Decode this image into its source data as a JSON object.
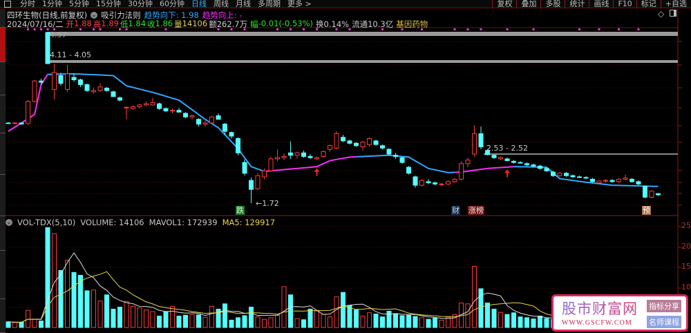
{
  "toolbar": {
    "tabs": [
      "分时",
      "1分钟",
      "5分钟",
      "15分钟",
      "30分钟",
      "60分钟",
      "日线",
      "周线",
      "月线",
      "多周期",
      "更多 >"
    ],
    "active_tab": "日线",
    "right_buttons": [
      "复权",
      "叠加",
      "多股",
      "统计",
      "画线",
      "F10",
      "标记",
      "+自选"
    ]
  },
  "title": {
    "stock": "四环生物(日线,前复权)",
    "indicator": "吸引力法则",
    "trend_down": "趋势向下: 1.98",
    "trend_up": "趋势向上: -"
  },
  "quote": {
    "date": "2024/07/16/二",
    "open_label": "开",
    "open": "1.88",
    "high_label": "高",
    "high": "1.89",
    "low_label": "低",
    "low": "1.84",
    "close_label": "收",
    "close": "1.86",
    "vol_label": "量",
    "vol": "14106",
    "amount": "额262.7万",
    "change_label": "幅",
    "change": "-0.01(-0.53%)",
    "turnover": "换0.14%",
    "float": "流通10.3亿",
    "sector": "基因药物"
  },
  "annotations": {
    "high_mark": "4.57",
    "band1": "4.11 - 4.05",
    "low_mark": "←1.72",
    "band2": "2.53 - 2.52",
    "tag_die": "跌",
    "tag_cai": "财",
    "tag_zhangbang": "涨榜",
    "tag_yu": "预"
  },
  "volume_header": {
    "name": "VOL-TDX(5,10)",
    "volume": "VOLUME: 14106",
    "mavol1": "MAVOL1: 172939",
    "ma5": "MA5: 129917"
  },
  "volume_axis": [
    "25",
    "20",
    "15",
    "10"
  ],
  "watermark": {
    "title": "股市财富网",
    "url": "WWW.GSCFW.COM",
    "btn1": "指标分享",
    "btn2": "名师课程"
  },
  "colors": {
    "up": "#ff3c3c",
    "down": "#54ffff",
    "trend_up": "#ff2cff",
    "trend_down": "#2fa8ff",
    "bg": "#000000"
  },
  "chart_data": {
    "type": "candlestick",
    "ylim": [
      1.55,
      4.6
    ],
    "ohlc": [
      [
        3.06,
        3.07,
        3.04,
        3.05
      ],
      [
        3.05,
        3.07,
        3.04,
        3.06
      ],
      [
        3.06,
        3.07,
        3.03,
        3.04
      ],
      [
        3.05,
        3.44,
        3.03,
        3.42
      ],
      [
        3.42,
        3.78,
        3.4,
        3.76
      ],
      [
        3.76,
        3.8,
        3.7,
        3.74
      ],
      [
        4.57,
        4.57,
        4.05,
        4.05
      ],
      [
        3.62,
        4.05,
        3.45,
        3.9
      ],
      [
        3.85,
        3.9,
        3.68,
        3.72
      ],
      [
        3.62,
        4.03,
        3.58,
        3.88
      ],
      [
        3.82,
        3.88,
        3.75,
        3.78
      ],
      [
        3.78,
        3.8,
        3.66,
        3.7
      ],
      [
        3.7,
        3.72,
        3.58,
        3.6
      ],
      [
        3.58,
        3.65,
        3.55,
        3.6
      ],
      [
        3.6,
        3.72,
        3.58,
        3.66
      ],
      [
        3.64,
        3.66,
        3.58,
        3.6
      ],
      [
        3.58,
        3.6,
        3.5,
        3.5
      ],
      [
        3.48,
        3.5,
        3.42,
        3.44
      ],
      [
        3.32,
        3.34,
        3.12,
        3.32
      ],
      [
        3.3,
        3.35,
        3.28,
        3.33
      ],
      [
        3.33,
        3.38,
        3.3,
        3.36
      ],
      [
        3.36,
        3.42,
        3.34,
        3.38
      ],
      [
        3.36,
        3.48,
        3.35,
        3.4
      ],
      [
        3.38,
        3.4,
        3.28,
        3.3
      ],
      [
        3.3,
        3.32,
        3.24,
        3.26
      ],
      [
        3.26,
        3.3,
        3.22,
        3.27
      ],
      [
        3.27,
        3.31,
        3.24,
        3.24
      ],
      [
        3.22,
        3.24,
        3.14,
        3.16
      ],
      [
        3.16,
        3.2,
        3.12,
        3.18
      ],
      [
        3.12,
        3.14,
        3.0,
        3.04
      ],
      [
        3.04,
        3.1,
        3.0,
        3.06
      ],
      [
        3.06,
        3.18,
        3.04,
        3.16
      ],
      [
        3.18,
        3.22,
        3.12,
        3.12
      ],
      [
        3.04,
        3.06,
        2.86,
        2.92
      ],
      [
        2.9,
        2.92,
        2.8,
        2.84
      ],
      [
        2.8,
        2.82,
        2.52,
        2.56
      ],
      [
        2.4,
        2.45,
        2.18,
        2.22
      ],
      [
        2.1,
        2.15,
        1.72,
        1.95
      ],
      [
        1.96,
        2.22,
        1.94,
        2.18
      ],
      [
        2.16,
        2.3,
        2.12,
        2.26
      ],
      [
        2.26,
        2.5,
        2.24,
        2.46
      ],
      [
        2.46,
        2.62,
        2.42,
        2.48
      ],
      [
        2.48,
        2.55,
        2.44,
        2.5
      ],
      [
        2.56,
        2.75,
        2.46,
        2.52
      ],
      [
        2.52,
        2.58,
        2.46,
        2.56
      ],
      [
        2.56,
        2.6,
        2.48,
        2.5
      ],
      [
        2.5,
        2.54,
        2.46,
        2.48
      ],
      [
        2.46,
        2.5,
        2.44,
        2.48
      ],
      [
        2.5,
        2.6,
        2.48,
        2.58
      ],
      [
        2.62,
        2.7,
        2.58,
        2.68
      ],
      [
        2.64,
        2.92,
        2.62,
        2.88
      ],
      [
        2.82,
        2.86,
        2.74,
        2.76
      ],
      [
        2.76,
        2.78,
        2.7,
        2.72
      ],
      [
        2.72,
        2.74,
        2.66,
        2.68
      ],
      [
        2.66,
        2.76,
        2.6,
        2.74
      ],
      [
        2.7,
        2.82,
        2.66,
        2.8
      ],
      [
        2.76,
        2.78,
        2.68,
        2.7
      ],
      [
        2.68,
        2.7,
        2.62,
        2.64
      ],
      [
        2.62,
        2.64,
        2.52,
        2.54
      ],
      [
        2.52,
        2.56,
        2.46,
        2.5
      ],
      [
        2.48,
        2.5,
        2.38,
        2.4
      ],
      [
        2.32,
        2.34,
        2.2,
        2.22
      ],
      [
        2.16,
        2.18,
        1.98,
        2.02
      ],
      [
        2.02,
        2.12,
        2.0,
        2.1
      ],
      [
        2.08,
        2.12,
        2.04,
        2.06
      ],
      [
        2.06,
        2.08,
        2.02,
        2.04
      ],
      [
        2.03,
        2.06,
        2.0,
        2.04
      ],
      [
        2.04,
        2.1,
        2.02,
        2.08
      ],
      [
        2.08,
        2.14,
        2.06,
        2.12
      ],
      [
        2.12,
        2.42,
        2.1,
        2.38
      ],
      [
        2.38,
        2.48,
        2.32,
        2.44
      ],
      [
        2.54,
        3.02,
        2.5,
        2.88
      ],
      [
        2.88,
        3.0,
        2.62,
        2.66
      ],
      [
        2.6,
        2.62,
        2.52,
        2.53
      ],
      [
        2.52,
        2.54,
        2.46,
        2.48
      ],
      [
        2.46,
        2.5,
        2.44,
        2.48
      ],
      [
        2.46,
        2.48,
        2.42,
        2.43
      ],
      [
        2.42,
        2.44,
        2.38,
        2.4
      ],
      [
        2.4,
        2.42,
        2.38,
        2.39
      ],
      [
        2.38,
        2.4,
        2.34,
        2.36
      ],
      [
        2.36,
        2.38,
        2.33,
        2.34
      ],
      [
        2.34,
        2.36,
        2.28,
        2.3
      ],
      [
        2.3,
        2.32,
        2.24,
        2.26
      ],
      [
        2.24,
        2.26,
        2.16,
        2.18
      ],
      [
        2.18,
        2.24,
        2.16,
        2.22
      ],
      [
        2.22,
        2.24,
        2.16,
        2.18
      ],
      [
        2.18,
        2.2,
        2.14,
        2.16
      ],
      [
        2.16,
        2.18,
        2.14,
        2.15
      ],
      [
        2.15,
        2.17,
        2.12,
        2.14
      ],
      [
        2.12,
        2.14,
        2.06,
        2.08
      ],
      [
        2.06,
        2.1,
        2.04,
        2.09
      ],
      [
        2.09,
        2.12,
        2.06,
        2.1
      ],
      [
        2.1,
        2.12,
        2.06,
        2.08
      ],
      [
        2.08,
        2.14,
        2.06,
        2.12
      ],
      [
        2.12,
        2.2,
        2.1,
        2.14
      ],
      [
        2.12,
        2.14,
        2.06,
        2.08
      ],
      [
        2.08,
        2.1,
        2.02,
        2.04
      ],
      [
        2.0,
        2.02,
        1.8,
        1.82
      ],
      [
        1.82,
        1.94,
        1.8,
        1.92
      ],
      [
        1.88,
        1.89,
        1.84,
        1.86
      ]
    ],
    "trend_keypoints": [
      [
        0,
        2.92
      ],
      [
        4,
        3.2
      ],
      [
        5,
        3.7
      ],
      [
        6,
        3.87
      ],
      [
        10,
        3.88
      ],
      [
        16,
        3.85
      ],
      [
        18,
        3.68
      ],
      [
        22,
        3.57
      ],
      [
        26,
        3.44
      ],
      [
        30,
        3.12
      ],
      [
        32,
        2.98
      ],
      [
        35,
        2.63
      ],
      [
        37,
        2.33
      ],
      [
        39,
        2.25
      ],
      [
        47,
        2.33
      ],
      [
        49,
        2.43
      ],
      [
        52,
        2.49
      ],
      [
        58,
        2.52
      ],
      [
        61,
        2.49
      ],
      [
        64,
        2.3
      ],
      [
        67,
        2.23
      ],
      [
        69,
        2.24
      ],
      [
        73,
        2.3
      ],
      [
        77,
        2.33
      ],
      [
        82,
        2.32
      ],
      [
        84,
        2.13
      ],
      [
        88,
        2.07
      ],
      [
        92,
        2.02
      ],
      [
        99,
        2.0
      ]
    ],
    "trend_segments": [
      {
        "from": 0,
        "to": 6,
        "dir": "up"
      },
      {
        "from": 6,
        "to": 39,
        "dir": "down"
      },
      {
        "from": 39,
        "to": 53,
        "dir": "up"
      },
      {
        "from": 53,
        "to": 68,
        "dir": "down"
      },
      {
        "from": 68,
        "to": 77,
        "dir": "up"
      },
      {
        "from": 77,
        "to": 99,
        "dir": "down"
      }
    ],
    "buy_arrows": [
      47,
      76
    ],
    "signal_dots": [
      3,
      4,
      5,
      6,
      7,
      11,
      13,
      14,
      17,
      18,
      24,
      32,
      34,
      36,
      41,
      43,
      45,
      47,
      50,
      52,
      57,
      60,
      63,
      68,
      70,
      72,
      76,
      80,
      87,
      90,
      93,
      96
    ],
    "volume_unit": "万",
    "volume_ylim": [
      0,
      27
    ],
    "volume": [
      1.4,
      1.2,
      1.3,
      4.2,
      2.0,
      1.6,
      24.5,
      23.0,
      14.0,
      16.5,
      13.5,
      12.8,
      9.0,
      9.2,
      6.5,
      8.0,
      4.5,
      5.0,
      6.4,
      5.2,
      4.8,
      4.3,
      3.9,
      2.8,
      3.8,
      5.2,
      2.8,
      3.0,
      3.2,
      3.1,
      2.5,
      5.2,
      4.5,
      5.8,
      1.8,
      2.4,
      2.9,
      5.0,
      2.6,
      2.0,
      2.4,
      3.0,
      10.0,
      8.0,
      2.2,
      1.9,
      4.5,
      4.2,
      3.2,
      2.6,
      7.5,
      8.6,
      5.4,
      4.3,
      2.8,
      3.6,
      3.3,
      2.6,
      4.0,
      3.4,
      2.9,
      3.0,
      2.7,
      2.4,
      2.0,
      2.3,
      1.8,
      2.5,
      3.2,
      6.0,
      5.8,
      15.0,
      9.5,
      6.0,
      4.5,
      3.7,
      3.2,
      3.6,
      2.6,
      2.4,
      2.1,
      2.8,
      2.2,
      2.0,
      1.7,
      1.5,
      1.8,
      2.0,
      1.6,
      1.4,
      1.8,
      1.5,
      1.3,
      1.4,
      1.2,
      1.3,
      1.5,
      2.2,
      1.9,
      1.41
    ],
    "volume_ma": [
      5,
      10
    ]
  }
}
